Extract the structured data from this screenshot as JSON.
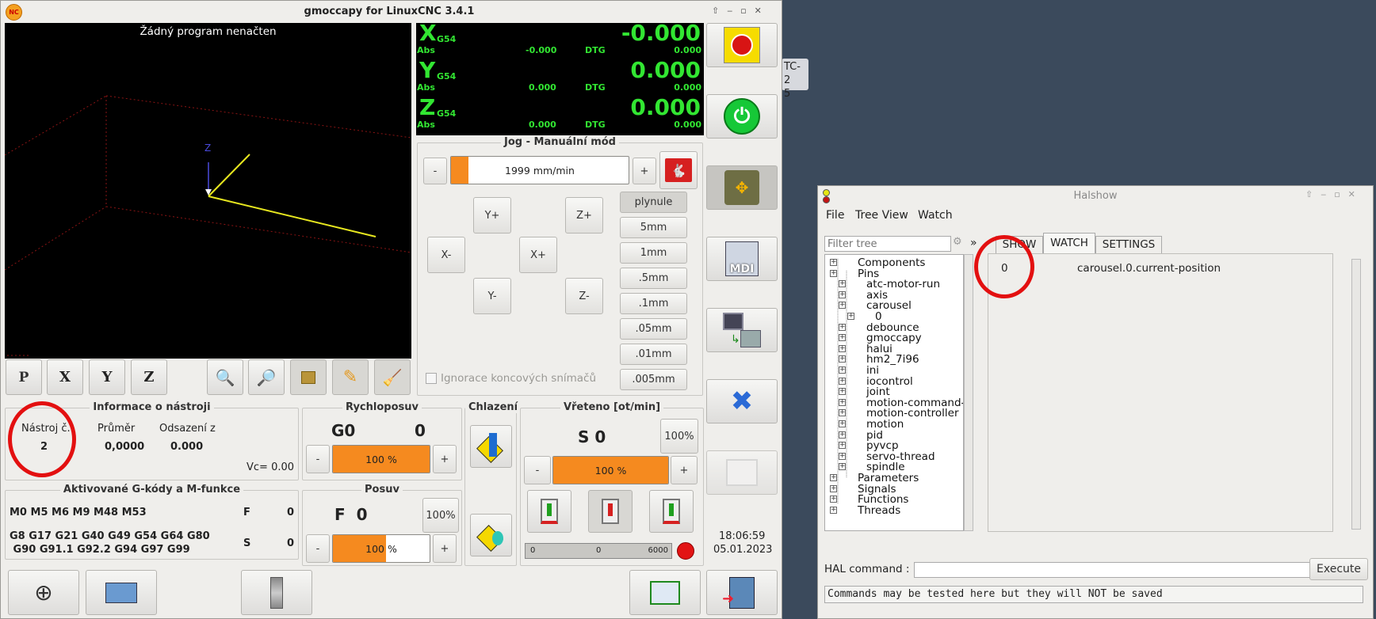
{
  "gmoccapy": {
    "title": "gmoccapy for LinuxCNC  3.4.1",
    "preview_msg": "Žádný program nenačten",
    "axis_label_z": "Z",
    "dro": {
      "x": {
        "axis": "X",
        "cs": "G54",
        "value": "-0.000",
        "abs_label": "Abs",
        "abs": "-0.000",
        "dtg_label": "DTG",
        "dtg": "0.000"
      },
      "y": {
        "axis": "Y",
        "cs": "G54",
        "value": "0.000",
        "abs_label": "Abs",
        "abs": "0.000",
        "dtg_label": "DTG",
        "dtg": "0.000"
      },
      "z": {
        "axis": "Z",
        "cs": "G54",
        "value": "0.000",
        "abs_label": "Abs",
        "abs": "0.000",
        "dtg_label": "DTG",
        "dtg": "0.000"
      }
    },
    "jog": {
      "title": "Jog - Manuální mód",
      "minus": "-",
      "plus": "+",
      "speed": "1999 mm/min",
      "speed_fraction": 0.1,
      "y_plus": "Y+",
      "y_minus": "Y-",
      "x_minus": "X-",
      "x_plus": "X+",
      "z_plus": "Z+",
      "z_minus": "Z-",
      "increments": [
        "plynule",
        "5mm",
        "1mm",
        ".5mm",
        ".1mm",
        ".05mm",
        ".01mm",
        ".005mm"
      ],
      "ignore_limits": "Ignorace koncových snímačů"
    },
    "tool": {
      "title": "Informace o nástroji",
      "col1": "Nástroj č.",
      "col2": "Průměr",
      "col3": "Odsazení z",
      "num": "2",
      "diameter": "0,0000",
      "offset": "0.000",
      "vc": "Vc= 0.00"
    },
    "rapid": {
      "title": "Rychloposuv",
      "g": "G0",
      "val": "0",
      "minus": "-",
      "plus": "+",
      "pct": "100 %",
      "fraction": 1.0
    },
    "feed": {
      "title": "Posuv",
      "f": "F  0",
      "btn": "100%",
      "minus": "-",
      "plus": "+",
      "pct": "100 %",
      "fraction": 0.55
    },
    "cool": {
      "title": "Chlazení"
    },
    "spindle": {
      "title": "Vřeteno [ot/min]",
      "s": "S 0",
      "btn": "100%",
      "minus": "-",
      "plus": "+",
      "pct": "100 %",
      "fraction": 1.0,
      "scale_min": "0",
      "scale_val": "0",
      "scale_max": "6000"
    },
    "gcodes": {
      "title": "Aktivované G-kódy a M-funkce",
      "m": "M0 M5 M6 M9 M48 M53",
      "g1": "G8 G17 G21 G40 G49 G54 G64 G80",
      "g2": " G90 G91.1 G92.2 G94 G97 G99",
      "f_label": "F",
      "f_val": "0",
      "s_label": "S",
      "s_val": "0"
    },
    "time": "18:06:59",
    "date": "05.01.2023",
    "mdi_label": "MDI"
  },
  "halshow": {
    "title": "Halshow",
    "menu": [
      "File",
      "Tree View",
      "Watch"
    ],
    "filter_placeholder": "Filter tree",
    "arrow": "»",
    "tabs": [
      "SHOW",
      "WATCH",
      "SETTINGS"
    ],
    "watch_value": "0",
    "watch_pin": "carousel.0.current-position",
    "tree_root": [
      "Components",
      "Pins"
    ],
    "tree_pins": [
      "atc-motor-run",
      "axis",
      "carousel",
      "0",
      "debounce",
      "gmoccapy",
      "halui",
      "hm2_7i96",
      "ini",
      "iocontrol",
      "joint",
      "motion-command-h",
      "motion-controller",
      "motion",
      "pid",
      "pyvcp",
      "servo-thread",
      "spindle"
    ],
    "tree_tail": [
      "Parameters",
      "Signals",
      "Functions",
      "Threads"
    ],
    "hal_label": "HAL command :",
    "execute": "Execute",
    "status": "Commands may be tested here but they will NOT be saved"
  },
  "bg": {
    "peek1": "TC-2",
    "peek2": "5"
  },
  "colors": {
    "accent": "#f58a1f",
    "dro": "#32e632",
    "circle": "#e31010"
  }
}
